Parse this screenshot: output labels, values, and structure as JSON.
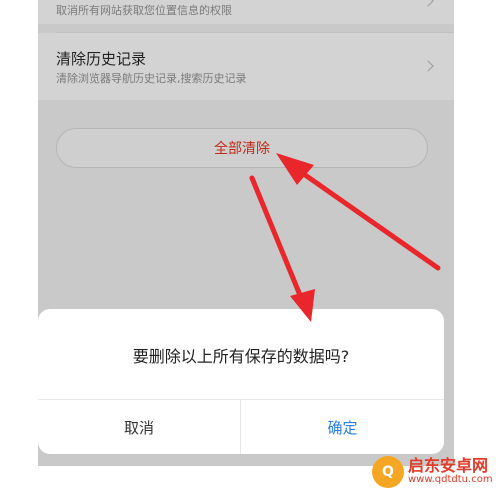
{
  "settings": {
    "location_item": {
      "subtitle": "取消所有网站获取您位置信息的权限"
    },
    "history_item": {
      "title": "清除历史记录",
      "subtitle": "清除浏览器导航历史记录,搜索历史记录"
    },
    "clear_all_label": "全部清除"
  },
  "dialog": {
    "message": "要删除以上所有保存的数据吗?",
    "cancel_label": "取消",
    "confirm_label": "确定"
  },
  "watermark": {
    "name": "启东安卓网",
    "url": "www.qdtdtu.com"
  },
  "colors": {
    "accent_red": "#c12a17",
    "confirm_blue": "#2b7de9",
    "arrow_red": "#e8262b"
  },
  "icons": [
    "chevron-right-icon",
    "chevron-right-icon",
    "red-arrow-annotation"
  ]
}
